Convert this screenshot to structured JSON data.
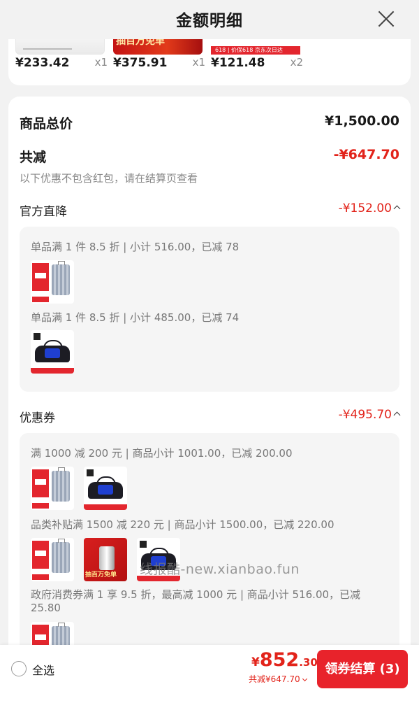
{
  "header": {
    "title": "金额明细"
  },
  "strip": {
    "items": [
      {
        "price": "¥233.42",
        "qty": "x1"
      },
      {
        "price": "¥375.91",
        "qty": "x1",
        "banner": "抽百万免单"
      },
      {
        "price": "¥121.48",
        "qty": "x2",
        "banner": "618 | 价保618 京东次日达"
      }
    ]
  },
  "summary": {
    "total_label": "商品总价",
    "total_value": "¥1,500.00",
    "discount_label": "共减",
    "discount_value": "-¥647.70",
    "note": "以下优惠不包含红包，请在结算页查看"
  },
  "official": {
    "label": "官方直降",
    "value": "-¥152.00",
    "lines": [
      "单品满 1 件 8.5 折 | 小计 516.00，已减 78",
      "单品满 1 件 8.5 折 | 小计 485.00，已减 74"
    ]
  },
  "coupon": {
    "label": "优惠券",
    "value": "-¥495.70",
    "lines": [
      "满 1000 减 200 元 | 商品小计 1001.00，已减 200.00",
      "品类补贴满 1500 减 220 元 | 商品小计 1500.00，已减 220.00",
      "政府消费券满 1 享 9.5 折，最高减 1000 元 | 商品小计 516.00，已减 25.80"
    ]
  },
  "watermark": "线报酷-new.xianbao.fun",
  "footer": {
    "select_all": "全选",
    "currency": "¥",
    "amount_int": "852",
    "amount_dec": ".30",
    "saved": "共减¥647.70",
    "checkout": "领券结算 (3)"
  },
  "colors": {
    "accent": "#e2231a",
    "button": "#e8232b"
  }
}
